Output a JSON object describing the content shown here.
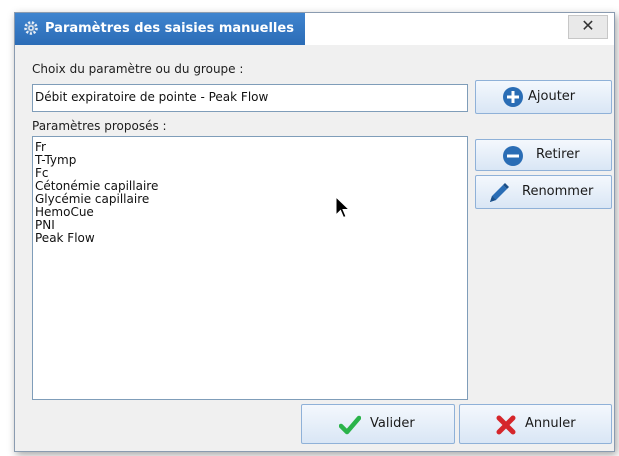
{
  "window": {
    "title": "Paramètres des saisies manuelles",
    "close_glyph": "✕",
    "title_bar_color": "#2f74c0"
  },
  "form": {
    "choice_label": "Choix du paramètre ou du groupe :",
    "choice_value": "Débit expiratoire de pointe - Peak Flow",
    "list_label": "Paramètres proposés :",
    "list_items": [
      "Fr",
      "T-Tymp",
      "Fc",
      "Cétonémie capillaire",
      "Glycémie capillaire",
      "HemoCue",
      "PNI",
      "Peak Flow"
    ]
  },
  "buttons": {
    "add": "Ajouter",
    "remove": "Retirer",
    "rename": "Renommer",
    "validate": "Valider",
    "cancel": "Annuler"
  },
  "icons": {
    "add": "plus-circle-icon",
    "remove": "minus-circle-icon",
    "rename": "pencil-icon",
    "validate": "checkmark-icon",
    "cancel": "cross-icon",
    "title": "settings-gear-icon"
  },
  "colors": {
    "accent_blue": "#2a6db5",
    "check_green": "#2bb34a",
    "cancel_red": "#d5262b"
  }
}
